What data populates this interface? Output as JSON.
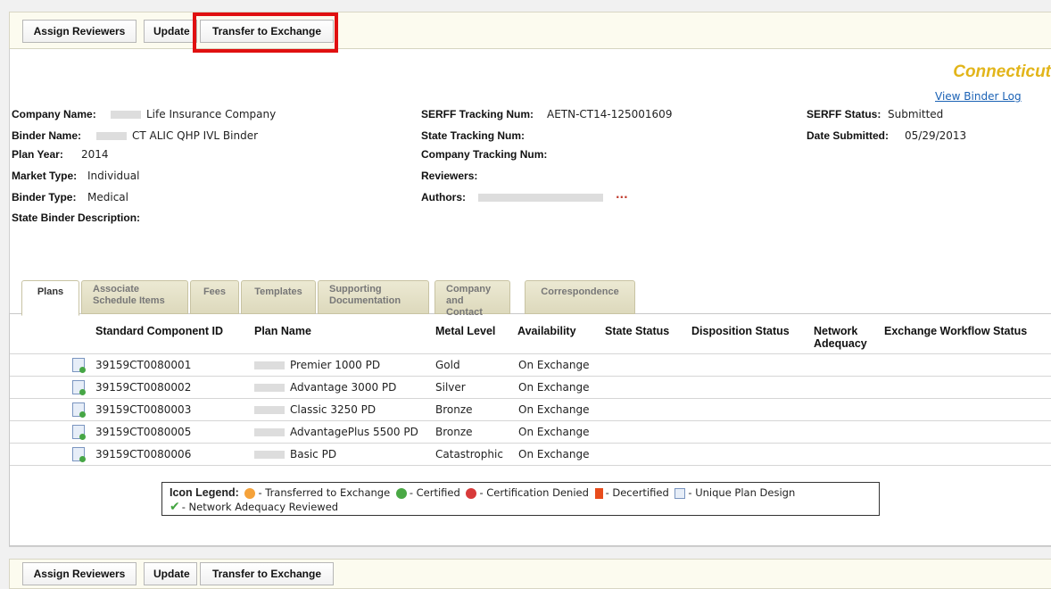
{
  "toolbar": {
    "assign_label": "Assign Reviewers",
    "update_label": "Update",
    "transfer_label": "Transfer to Exchange"
  },
  "header": {
    "state": "Connecticut",
    "binder_log": "View Binder Log"
  },
  "fields": {
    "company_name_label": "Company Name:",
    "company_name_value": "Life Insurance Company",
    "binder_name_label": "Binder Name:",
    "binder_name_value": "CT ALIC QHP IVL Binder",
    "plan_year_label": "Plan Year:",
    "plan_year_value": "2014",
    "market_type_label": "Market Type:",
    "market_type_value": "Individual",
    "binder_type_label": "Binder Type:",
    "binder_type_value": "Medical",
    "state_binder_desc_label": "State Binder Description:",
    "serff_tracking_label": "SERFF Tracking Num:",
    "serff_tracking_value": "AETN-CT14-125001609",
    "state_tracking_label": "State Tracking Num:",
    "company_tracking_label": "Company Tracking Num:",
    "reviewers_label": "Reviewers:",
    "authors_label": "Authors:",
    "authors_more": "···",
    "serff_status_label": "SERFF Status:",
    "serff_status_value": "Submitted",
    "date_submitted_label": "Date Submitted:",
    "date_submitted_value": "05/29/2013"
  },
  "tabs": [
    {
      "label": "Plans"
    },
    {
      "label": "Associate Schedule Items"
    },
    {
      "label": "Fees"
    },
    {
      "label": "Templates"
    },
    {
      "label": "Supporting Documentation"
    },
    {
      "label": "Company and Contact"
    },
    {
      "label": "Correspondence"
    }
  ],
  "table": {
    "headers": [
      "Standard Component ID",
      "Plan Name",
      "Metal Level",
      "Availability",
      "State Status",
      "Disposition Status",
      "Network Adequacy",
      "Exchange Workflow Status"
    ],
    "rows": [
      {
        "id": "39159CT0080001",
        "plan": "Premier 1000 PD",
        "metal": "Gold",
        "avail": "On Exchange"
      },
      {
        "id": "39159CT0080002",
        "plan": "Advantage 3000 PD",
        "metal": "Silver",
        "avail": "On Exchange"
      },
      {
        "id": "39159CT0080003",
        "plan": "Classic 3250 PD",
        "metal": "Bronze",
        "avail": "On Exchange"
      },
      {
        "id": "39159CT0080005",
        "plan": "AdvantagePlus 5500 PD",
        "metal": "Bronze",
        "avail": "On Exchange"
      },
      {
        "id": "39159CT0080006",
        "plan": "Basic PD",
        "metal": "Catastrophic",
        "avail": "On Exchange"
      }
    ]
  },
  "legend": {
    "title": "Icon Legend:",
    "transferred": "- Transferred to Exchange",
    "certified": "- Certified",
    "denied": "- Certification Denied",
    "decertified": "- Decertified",
    "unique": "- Unique Plan Design",
    "network": "- Network Adequacy Reviewed"
  },
  "colors": {
    "state_title": "#e2b51a",
    "highlight_box": "#e01010",
    "link": "#1b62b5"
  }
}
